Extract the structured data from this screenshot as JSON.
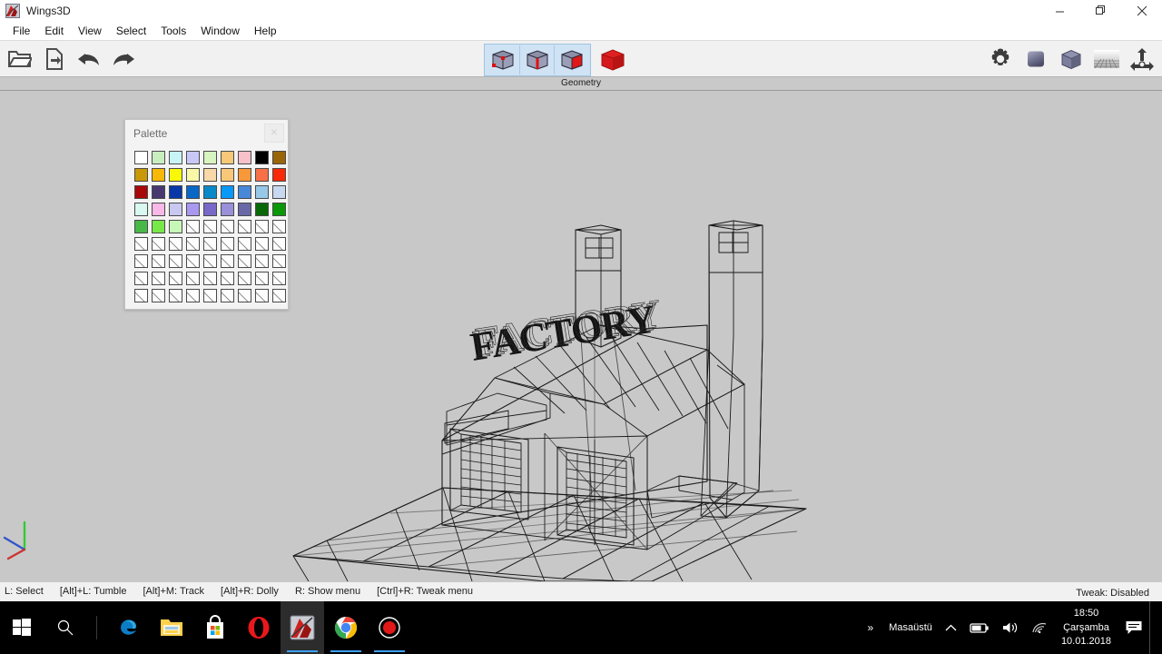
{
  "window": {
    "title": "Wings3D",
    "app_icon": "wings3d-icon",
    "minimize_label": "─",
    "restore_label": "❐",
    "close_label": "✕"
  },
  "menubar": {
    "items": [
      {
        "label": "File",
        "name": "menu-file"
      },
      {
        "label": "Edit",
        "name": "menu-edit"
      },
      {
        "label": "View",
        "name": "menu-view"
      },
      {
        "label": "Select",
        "name": "menu-select"
      },
      {
        "label": "Tools",
        "name": "menu-tools"
      },
      {
        "label": "Window",
        "name": "menu-window"
      },
      {
        "label": "Help",
        "name": "menu-help"
      }
    ]
  },
  "toolbar": {
    "left_buttons": [
      {
        "name": "open-file-button",
        "icon": "folder-open-icon",
        "label": "Open"
      },
      {
        "name": "save-file-button",
        "icon": "file-export-icon",
        "label": "Save"
      },
      {
        "name": "undo-button",
        "icon": "undo-arrow-icon",
        "label": "Undo"
      },
      {
        "name": "redo-button",
        "icon": "redo-arrow-icon",
        "label": "Redo"
      }
    ],
    "selection_modes": [
      {
        "name": "vertex-mode-button",
        "icon": "cube-vertex-icon",
        "label": "Vertex",
        "selected": true
      },
      {
        "name": "edge-mode-button",
        "icon": "cube-edge-icon",
        "label": "Edge",
        "selected": true
      },
      {
        "name": "face-mode-button",
        "icon": "cube-face-icon",
        "label": "Face",
        "selected": true
      },
      {
        "name": "body-mode-button",
        "icon": "cube-body-icon",
        "label": "Body",
        "selected": false
      }
    ],
    "right_buttons": [
      {
        "name": "preferences-button",
        "icon": "gear-icon",
        "label": "Preferences"
      },
      {
        "name": "smooth-shade-button",
        "icon": "smooth-cube-icon",
        "label": "Smooth Shading"
      },
      {
        "name": "flat-shade-button",
        "icon": "flat-cube-icon",
        "label": "Flat Shading"
      },
      {
        "name": "show-ground-button",
        "icon": "ground-grid-icon",
        "label": "Show Ground"
      },
      {
        "name": "show-axes-button",
        "icon": "axes-icon",
        "label": "Show Axes"
      }
    ]
  },
  "geometry_strip": {
    "label": "Geometry"
  },
  "palette": {
    "title": "Palette",
    "close_label": "✕",
    "colors": [
      "#ffffff",
      "#c8eec0",
      "#c8f4f8",
      "#c8c8f8",
      "#d8f4c0",
      "#f8c878",
      "#f8c0c8",
      "#000000",
      "#9a6408",
      "#c89808",
      "#f8b808",
      "#f8f808",
      "#f8f8a8",
      "#f8d8a8",
      "#f8c878",
      "#f89838",
      "#f87048",
      "#f82808",
      "#a80808",
      "#483870",
      "#0838a8",
      "#0868c8",
      "#0888c8",
      "#0898f8",
      "#4888d8",
      "#98c8e8",
      "#c8d8f0",
      "#d8f8f0",
      "#f8b8e8",
      "#c8c8f0",
      "#a898f0",
      "#7868c8",
      "#9890d8",
      "#6868a8",
      "#086808",
      "#089808",
      "#48b848",
      "#78e848",
      "#c8f8b8",
      null,
      null,
      null,
      null,
      null,
      null,
      null,
      null,
      null,
      null,
      null,
      null,
      null,
      null,
      null,
      null,
      null,
      null,
      null,
      null,
      null,
      null,
      null,
      null,
      null,
      null,
      null,
      null,
      null,
      null,
      null,
      null,
      null,
      null,
      null,
      null,
      null,
      null,
      null,
      null,
      null,
      null
    ]
  },
  "viewport": {
    "background_color": "#c8c8c8",
    "model_name": "factory-building-wireframe",
    "model_text": "FACTORY",
    "axes": {
      "x_color": "#c03030",
      "y_color": "#30c030",
      "z_color": "#3050c0"
    }
  },
  "statusbar": {
    "hints": [
      "L: Select",
      "[Alt]+L: Tumble",
      "[Alt]+M: Track",
      "[Alt]+R: Dolly",
      "R: Show menu",
      "[Ctrl]+R: Tweak menu"
    ],
    "tweak_status": "Tweak: Disabled"
  },
  "taskbar": {
    "start_label": "start-button",
    "search_label": "search-button",
    "items": [
      {
        "name": "taskbar-edge",
        "icon": "edge-icon",
        "label": "Microsoft Edge",
        "running": false,
        "active": false
      },
      {
        "name": "taskbar-file-explorer",
        "icon": "folder-icon",
        "label": "File Explorer",
        "running": false,
        "active": false
      },
      {
        "name": "taskbar-store",
        "icon": "store-icon",
        "label": "Microsoft Store",
        "running": false,
        "active": false
      },
      {
        "name": "taskbar-opera",
        "icon": "opera-icon",
        "label": "Opera",
        "running": false,
        "active": false
      },
      {
        "name": "taskbar-wings3d",
        "icon": "wings3d-icon",
        "label": "Wings3D",
        "running": true,
        "active": true
      },
      {
        "name": "taskbar-chrome",
        "icon": "chrome-icon",
        "label": "Google Chrome",
        "running": true,
        "active": false
      },
      {
        "name": "taskbar-recorder",
        "icon": "record-icon",
        "label": "Screen Recorder",
        "running": true,
        "active": false
      }
    ],
    "tray": {
      "overflow_label": "»",
      "desktop_label": "Masaüstü",
      "chevron_label": "∧",
      "battery_icon": "battery-icon",
      "volume_icon": "speaker-icon",
      "network_icon": "wifi-icon",
      "time": "18:50",
      "day": "Çarşamba",
      "date": "10.01.2018",
      "notifications_icon": "notification-icon"
    }
  }
}
